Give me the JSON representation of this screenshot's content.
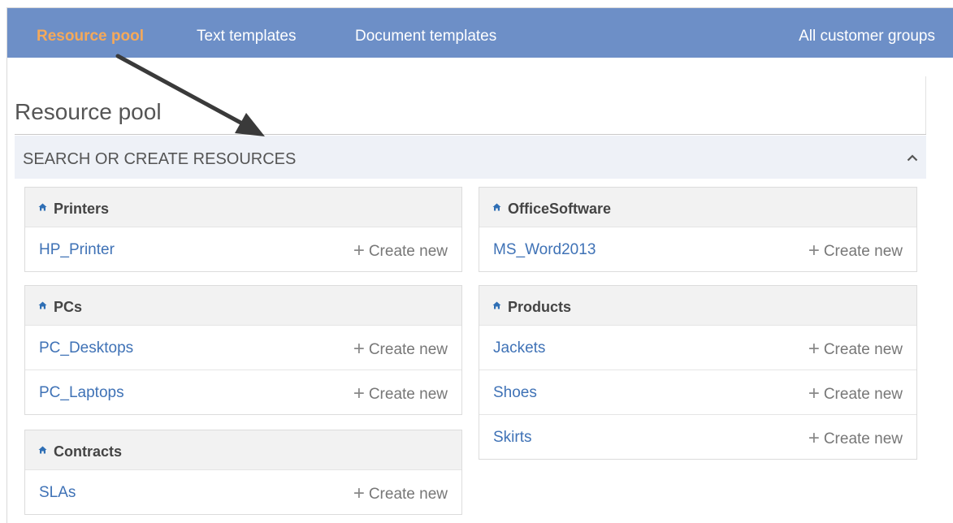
{
  "nav": {
    "resource_pool": "Resource pool",
    "text_templates": "Text templates",
    "document_templates": "Document templates",
    "all_customer_groups": "All customer groups"
  },
  "page": {
    "title": "Resource pool",
    "section_label": "SEARCH OR CREATE RESOURCES"
  },
  "groups": [
    {
      "title": "Printers",
      "items": [
        {
          "name": "HP_Printer",
          "action": "Create new"
        }
      ]
    },
    {
      "title": "PCs",
      "items": [
        {
          "name": "PC_Desktops",
          "action": "Create new"
        },
        {
          "name": "PC_Laptops",
          "action": "Create new"
        }
      ]
    },
    {
      "title": "Contracts",
      "items": [
        {
          "name": "SLAs",
          "action": "Create new"
        }
      ]
    },
    {
      "title": "OfficeSoftware",
      "items": [
        {
          "name": "MS_Word2013",
          "action": "Create new"
        }
      ]
    },
    {
      "title": "Products",
      "items": [
        {
          "name": "Jackets",
          "action": "Create new"
        },
        {
          "name": "Shoes",
          "action": "Create new"
        },
        {
          "name": "Skirts",
          "action": "Create new"
        }
      ]
    }
  ],
  "icons": {
    "group_icon": "home-icon",
    "collapse_icon": "chevron-up-icon",
    "add_icon": "plus-icon"
  },
  "colors": {
    "nav_bg": "#6d8fc7",
    "nav_active": "#f5a95a",
    "link": "#3f72b6",
    "section_bg": "#eef1f7"
  }
}
